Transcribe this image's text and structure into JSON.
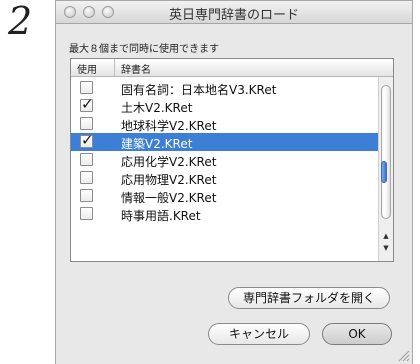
{
  "step_number": "2",
  "window": {
    "title": "英日専門辞書のロード"
  },
  "instruction": "最大８個まで同時に使用できます",
  "table": {
    "columns": [
      "使用",
      "辞書名"
    ],
    "rows": [
      {
        "label": "固有名詞：日本地名V3.KRet",
        "checked": false,
        "selected": false
      },
      {
        "label": "土木V2.KRet",
        "checked": true,
        "selected": false
      },
      {
        "label": "地球科学V2.KRet",
        "checked": false,
        "selected": false
      },
      {
        "label": "建築V2.KRet",
        "checked": true,
        "selected": true
      },
      {
        "label": "応用化学V2.KRet",
        "checked": false,
        "selected": false
      },
      {
        "label": "応用物理V2.KRet",
        "checked": false,
        "selected": false
      },
      {
        "label": "情報一般V2.KRet",
        "checked": false,
        "selected": false
      },
      {
        "label": "時事用語.KRet",
        "checked": false,
        "selected": false
      }
    ]
  },
  "buttons": {
    "open_folder": "専門辞書フォルダを開く",
    "cancel": "キャンセル",
    "ok": "OK"
  },
  "colors": {
    "selection": "#3d7ed6"
  }
}
